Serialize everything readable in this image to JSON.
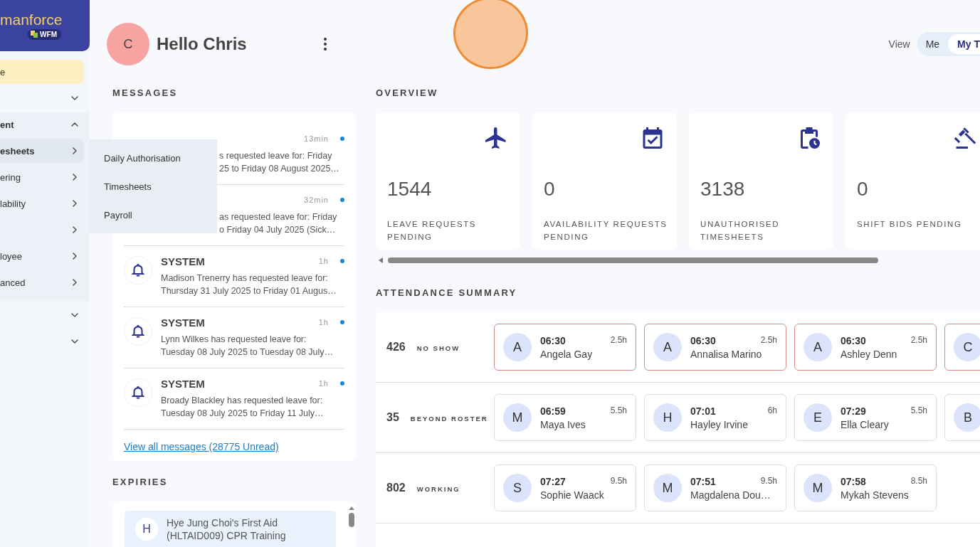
{
  "sidebar": {
    "logo": {
      "wordmark": "manforce",
      "badge": "WFM"
    },
    "items": [
      {
        "label": "e",
        "selected": true
      },
      {
        "expanded": false,
        "selected": false
      },
      {
        "label": "ent",
        "expanded": true,
        "children": [
          {
            "label": "esheets",
            "selected": true
          },
          {
            "label": "ering",
            "selected": false
          },
          {
            "label": "lability",
            "selected": false
          },
          {
            "selected": false
          },
          {
            "label": "loyee",
            "selected": false
          },
          {
            "label": "anced",
            "selected": false
          }
        ]
      },
      {
        "expanded": false,
        "selected": false
      },
      {
        "expanded": false,
        "selected": false
      }
    ]
  },
  "submenu": {
    "items": [
      "Daily Authorisation",
      "Timesheets",
      "Payroll"
    ]
  },
  "header": {
    "avatar": "C",
    "greeting": "Hello Chris",
    "view_label": "View",
    "view_options": [
      {
        "label": "Me",
        "selected": false
      },
      {
        "label": "My T",
        "selected": true
      }
    ]
  },
  "messages": {
    "title": "MESSAGES",
    "items": [
      {
        "kind": "covered",
        "time": "13min",
        "unread": true,
        "lines": [
          "s requested leave for: Friday",
          "25 to Friday 08 August 2025…"
        ]
      },
      {
        "kind": "covered",
        "time": "32min",
        "unread": true,
        "lines": [
          "as requested leave for: Friday",
          "o Friday 04 July 2025 (Sick…"
        ]
      },
      {
        "kind": "full",
        "sender": "SYSTEM",
        "time": "1h",
        "unread": true,
        "lines": [
          "Madison Trenerry has requested leave for:",
          "Thursday 31 July 2025 to Friday 01 Augus…"
        ]
      },
      {
        "kind": "full",
        "sender": "SYSTEM",
        "time": "1h",
        "unread": true,
        "lines": [
          "Lynn Wilkes has requested leave for:",
          "Tuesday 08 July 2025 to Tuesday 08 July…"
        ]
      },
      {
        "kind": "full",
        "sender": "SYSTEM",
        "time": "1h",
        "unread": true,
        "lines": [
          "Broady Blackley has requested leave for:",
          "Tuesday 08 July 2025 to Friday 11 July…"
        ]
      }
    ],
    "link": "View all messages (28775 Unread)"
  },
  "expiries": {
    "title": "EXPIRIES",
    "items": [
      {
        "avatar": "H",
        "text": "Hye Jung Choi's First Aid (HLTAID009) CPR Training"
      }
    ]
  },
  "overview": {
    "title": "OVERVIEW",
    "cards": [
      {
        "value": "1544",
        "label": "LEAVE REQUESTS PENDING"
      },
      {
        "value": "0",
        "label": "AVAILABILITY REQUESTS PENDING"
      },
      {
        "value": "3138",
        "label": "UNAUTHORISED TIMESHEETS"
      },
      {
        "value": "0",
        "label": "SHIFT BIDS PENDING"
      }
    ]
  },
  "attendance": {
    "title": "ATTENDANCE SUMMARY",
    "rows": [
      {
        "count": "426",
        "label": "NO SHOW",
        "kind": "alert",
        "chips": [
          {
            "initial": "A",
            "time": "06:30",
            "hours": "2.5h",
            "name": "Angela Gay"
          },
          {
            "initial": "A",
            "time": "06:30",
            "hours": "2.5h",
            "name": "Annalisa Marino"
          },
          {
            "initial": "A",
            "time": "06:30",
            "hours": "2.5h",
            "name": "Ashley Denn"
          },
          {
            "initial": "C"
          }
        ]
      },
      {
        "count": "35",
        "label": "BEYOND ROSTER",
        "kind": "normal",
        "chips": [
          {
            "initial": "M",
            "time": "06:59",
            "hours": "5.5h",
            "name": "Maya Ives"
          },
          {
            "initial": "H",
            "time": "07:01",
            "hours": "6h",
            "name": "Hayley Irvine"
          },
          {
            "initial": "E",
            "time": "07:29",
            "hours": "5.5h",
            "name": "Ella Cleary"
          },
          {
            "initial": "B"
          }
        ]
      },
      {
        "count": "802",
        "label": "WORKING",
        "kind": "normal",
        "chips": [
          {
            "initial": "S",
            "time": "07:27",
            "hours": "9.5h",
            "name": "Sophie Waack"
          },
          {
            "initial": "M",
            "time": "07:51",
            "hours": "9.5h",
            "name": "Magdalena Dou…"
          },
          {
            "initial": "M",
            "time": "07:58",
            "hours": "8.5h",
            "name": "Mykah Stevens"
          }
        ]
      }
    ]
  }
}
